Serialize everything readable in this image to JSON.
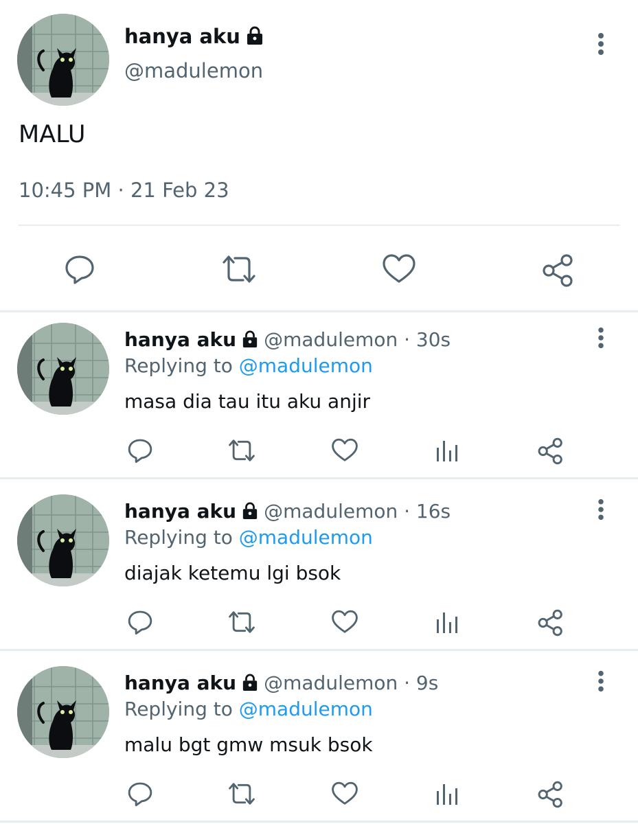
{
  "main_tweet": {
    "display_name": "hanya aku",
    "handle": "@madulemon",
    "text": "MALU",
    "timestamp": "10:45 PM · 21 Feb 23",
    "actions": [
      "reply-icon",
      "retweet-icon",
      "like-icon",
      "share-icon"
    ]
  },
  "replies": [
    {
      "display_name": "hanya aku",
      "meta": "@madulemon · 30s",
      "replying_prefix": "Replying to",
      "replying_to": "@madulemon",
      "text": "masa dia tau itu aku anjir"
    },
    {
      "display_name": "hanya aku",
      "meta": "@madulemon · 16s",
      "replying_prefix": "Replying to",
      "replying_to": "@madulemon",
      "text": "diajak ketemu lgi bsok"
    },
    {
      "display_name": "hanya aku",
      "meta": "@madulemon · 9s",
      "replying_prefix": "Replying to",
      "replying_to": "@madulemon",
      "text": "malu bgt gmw msuk bsok"
    }
  ],
  "reply_actions": [
    "reply-icon",
    "retweet-icon",
    "like-icon",
    "analytics-icon",
    "share-icon"
  ],
  "colors": {
    "text": "#0f1419",
    "secondary": "#536471",
    "link": "#1d9bf0",
    "divider": "#e6ecf0"
  }
}
